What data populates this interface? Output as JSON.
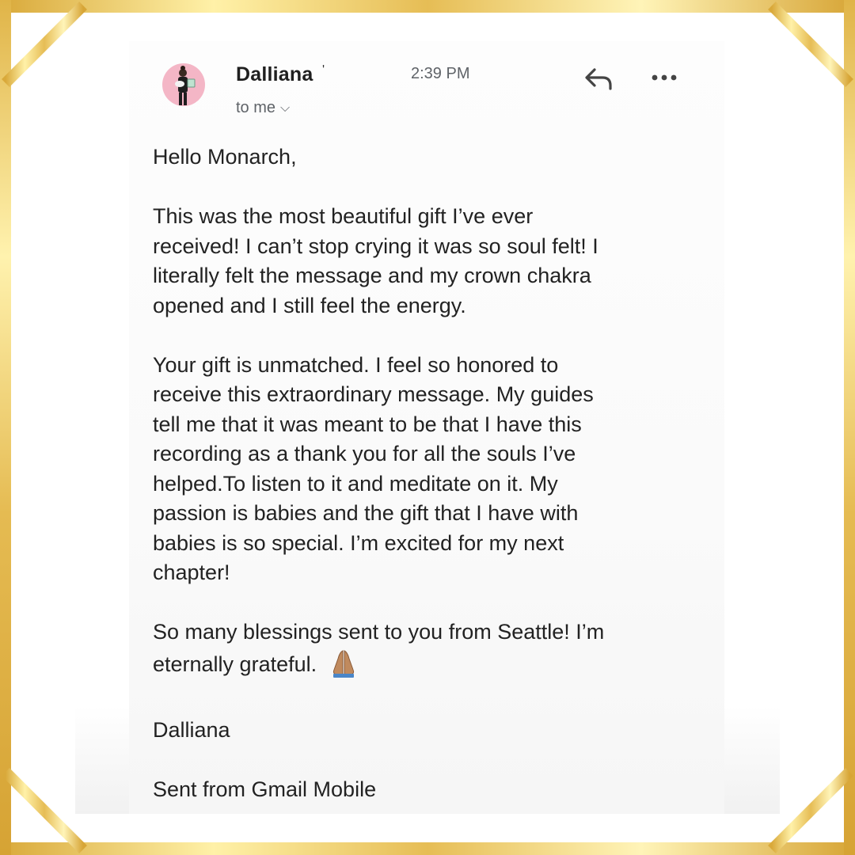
{
  "email": {
    "sender": {
      "name": "Dalliana",
      "name_suffix": "'",
      "avatar": "person-holding-baby-avatar"
    },
    "recipient_label": "to me",
    "time": "2:39 PM",
    "actions": {
      "reply_icon": "reply-arrow-icon",
      "more_icon": "more-options-icon"
    },
    "body": {
      "greeting": "Hello Monarch,",
      "paragraph_1": {
        "lines": [
          "This was the most beautiful gift I’ve ever",
          "received!  I can’t stop crying it was so soul felt! I",
          "literally felt the message  and my crown chakra",
          "opened and I still feel the energy."
        ]
      },
      "paragraph_2": {
        "lines": [
          "Your gift is unmatched. I feel so honored to",
          "receive this extraordinary message. My guides",
          "tell me that it was meant to be that I have this",
          "recording as a thank you for all the souls I’ve",
          "helped.To listen to it and meditate on it. My",
          "passion is babies and the gift that I have with",
          "babies is so special. I’m excited for my next",
          "chapter!"
        ]
      },
      "paragraph_3": {
        "lines": [
          "So many blessings sent to you from Seattle! I’m",
          "eternally grateful."
        ],
        "emoji": "folded-hands-emoji"
      },
      "signature": "Dalliana",
      "footer": "Sent from Gmail Mobile"
    }
  },
  "colors": {
    "gold_light": "#fff3b0",
    "gold_mid": "#e8c05a",
    "gold_dark": "#c99a2e",
    "text": "#222222",
    "secondary_text": "#5f6368"
  }
}
